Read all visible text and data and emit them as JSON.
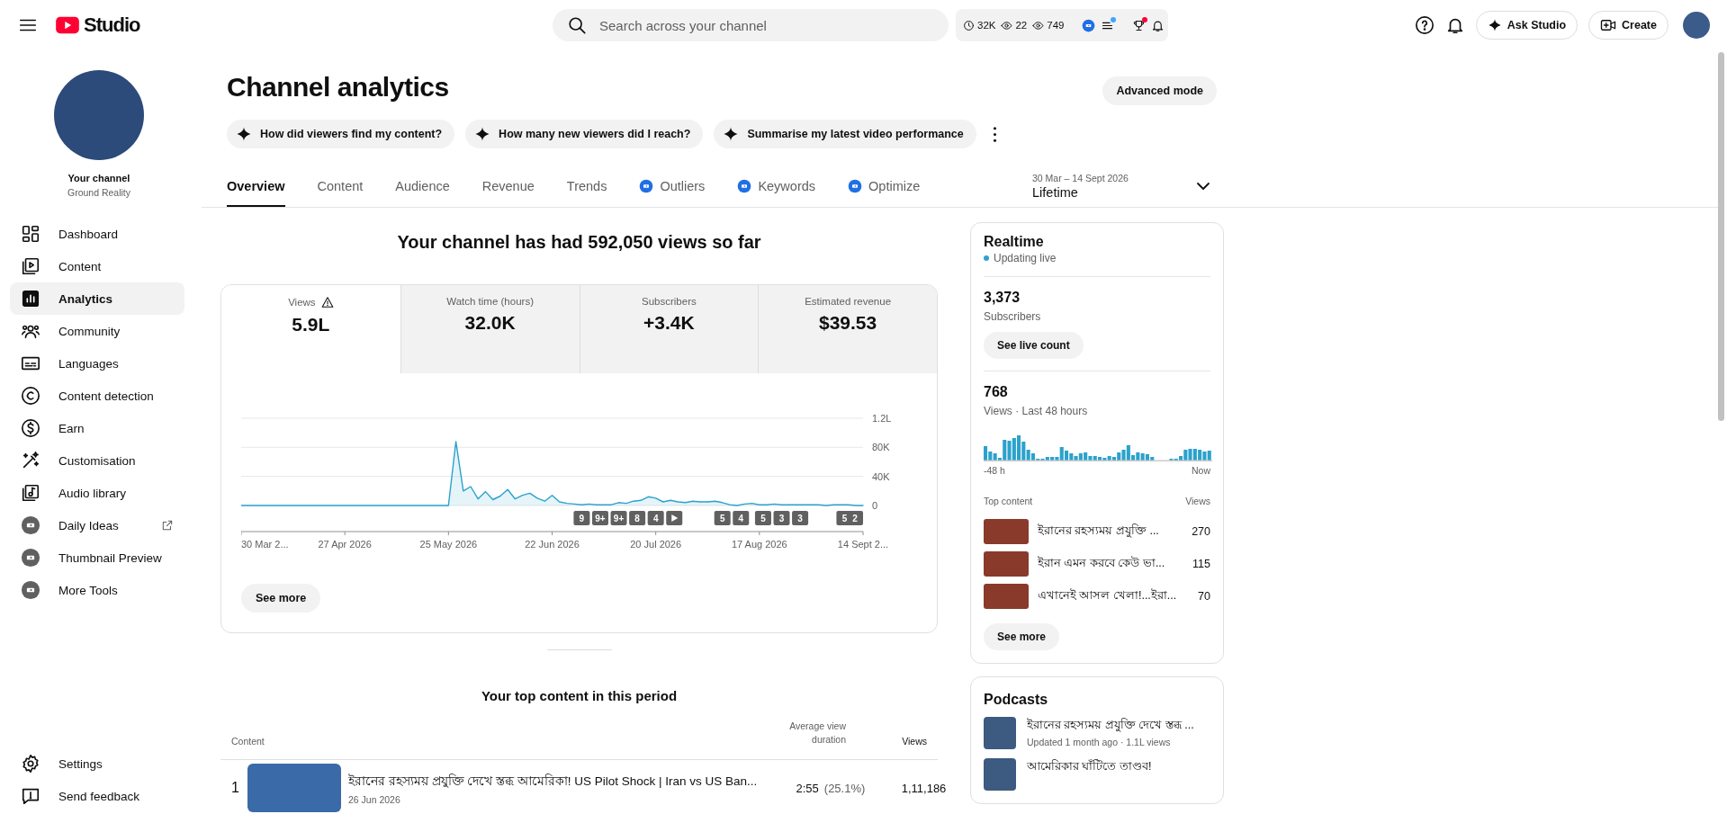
{
  "header": {
    "logo_text": "Studio",
    "search": {
      "placeholder": "Search across your channel"
    },
    "stats": [
      "32K",
      "22",
      "749"
    ],
    "toolbar_icons": [
      {
        "unread": false
      },
      {
        "unread": true,
        "color": "#3ea6ff"
      },
      {
        "unread": true,
        "color": "#ff0033"
      },
      {
        "unread": false
      }
    ],
    "ask_button": "Ask Studio",
    "create_button": "Create"
  },
  "sidebar": {
    "channel": {
      "title": "Your channel",
      "name": "Ground Reality"
    },
    "items": [
      {
        "label": "Dashboard",
        "selected": false,
        "external": false
      },
      {
        "label": "Content",
        "selected": false,
        "external": false
      },
      {
        "label": "Analytics",
        "selected": true,
        "external": false
      },
      {
        "label": "Community",
        "selected": false,
        "external": false
      },
      {
        "label": "Languages",
        "selected": false,
        "external": false
      },
      {
        "label": "Content detection",
        "selected": false,
        "external": false
      },
      {
        "label": "Earn",
        "selected": false,
        "external": false
      },
      {
        "label": "Customisation",
        "selected": false,
        "external": false
      },
      {
        "label": "Audio library",
        "selected": false,
        "external": false
      },
      {
        "label": "Daily Ideas",
        "selected": false,
        "external": true
      },
      {
        "label": "Thumbnail Preview",
        "selected": false,
        "external": false
      },
      {
        "label": "More Tools",
        "selected": false,
        "external": false
      }
    ],
    "footer_items": [
      "Settings",
      "Send feedback"
    ]
  },
  "page": {
    "title": "Channel analytics",
    "advanced_button": "Advanced mode",
    "chips": [
      "How did viewers find my content?",
      "How many new viewers did I reach?",
      "Summarise my latest video performance"
    ],
    "tabs": [
      {
        "label": "Overview",
        "selected": true,
        "badge": false
      },
      {
        "label": "Content",
        "selected": false,
        "badge": false
      },
      {
        "label": "Audience",
        "selected": false,
        "badge": false
      },
      {
        "label": "Revenue",
        "selected": false,
        "badge": false
      },
      {
        "label": "Trends",
        "selected": false,
        "badge": false
      },
      {
        "label": "Outliers",
        "selected": false,
        "badge": true
      },
      {
        "label": "Keywords",
        "selected": false,
        "badge": true
      },
      {
        "label": "Optimize",
        "selected": false,
        "badge": true
      }
    ],
    "date_range": {
      "range": "30 Mar – 14 Sept 2026",
      "period": "Lifetime"
    }
  },
  "overview": {
    "headline": "Your channel has had 592,050 views so far",
    "metrics": [
      {
        "label": "Views",
        "value": "5.9L",
        "selected": true,
        "warning": true
      },
      {
        "label": "Watch time (hours)",
        "value": "32.0K",
        "selected": false,
        "warning": false
      },
      {
        "label": "Subscribers",
        "value": "+3.4K",
        "selected": false,
        "warning": false
      },
      {
        "label": "Estimated revenue",
        "value": "$39.53",
        "selected": false,
        "warning": false
      }
    ],
    "chart_data": {
      "type": "area",
      "categories": [
        "30 Mar 2...",
        null,
        null,
        null,
        null,
        null,
        null,
        null,
        null,
        null,
        null,
        null,
        null,
        null,
        "27 Apr 2026",
        null,
        null,
        null,
        null,
        null,
        null,
        null,
        null,
        null,
        null,
        null,
        null,
        null,
        "25 May 2026",
        null,
        null,
        null,
        null,
        null,
        null,
        null,
        null,
        null,
        null,
        null,
        null,
        null,
        "22 Jun 2026",
        null,
        null,
        null,
        null,
        null,
        null,
        null,
        null,
        null,
        null,
        null,
        null,
        null,
        "20 Jul 2026",
        null,
        null,
        null,
        null,
        null,
        null,
        null,
        null,
        null,
        null,
        null,
        null,
        null,
        "17 Aug 2026",
        null,
        null,
        null,
        null,
        null,
        null,
        null,
        null,
        null,
        null,
        null,
        null,
        null,
        "14 Sept 2..."
      ],
      "series": [
        {
          "color": "#2ba2cc",
          "values": [
            0,
            0,
            0,
            0,
            0,
            0,
            0,
            0,
            0,
            0,
            0,
            0,
            0,
            0,
            0,
            0,
            0,
            0,
            0,
            0,
            0,
            0,
            0,
            0,
            0,
            0,
            0,
            0,
            0,
            88000,
            20000,
            26000,
            9000,
            19000,
            8000,
            13000,
            22000,
            9000,
            14000,
            17000,
            10000,
            6000,
            14000,
            5000,
            3000,
            2000,
            1000,
            2000,
            1000,
            1000,
            1000,
            4000,
            3000,
            6000,
            7000,
            12000,
            10000,
            5000,
            7000,
            5000,
            4000,
            6000,
            5000,
            5000,
            6000,
            4000,
            1000,
            0,
            2000,
            3000,
            1000,
            1000,
            2000,
            1000,
            1000,
            1000,
            1000,
            1000,
            1000,
            0,
            1000,
            1000,
            1000,
            0,
            0
          ]
        }
      ],
      "ylim": [
        0,
        120000
      ],
      "yticks": [
        0,
        {
          "value": 40000,
          "label": "40K"
        },
        {
          "value": 80000,
          "label": "80K"
        }
      ]
    },
    "y_axis_max_label": "1.2L",
    "video_markers": [
      {
        "kind": "count",
        "text": "9"
      },
      {
        "kind": "count",
        "text": "9+"
      },
      {
        "kind": "count",
        "text": "9+"
      },
      {
        "kind": "count",
        "text": "8"
      },
      {
        "kind": "count",
        "text": "4"
      },
      {
        "kind": "play"
      },
      {
        "kind": "count",
        "text": "5"
      },
      {
        "kind": "count",
        "text": "4"
      },
      {
        "kind": "count",
        "text": "5"
      },
      {
        "kind": "count",
        "text": "3"
      },
      {
        "kind": "count",
        "text": "3"
      },
      {
        "kind": "count",
        "text": "5"
      },
      {
        "kind": "count",
        "text": "2"
      }
    ],
    "see_more": "See more"
  },
  "top_content": {
    "title": "Your top content in this period",
    "columns": [
      "Content",
      "Average view duration",
      "Views"
    ],
    "rows": [
      {
        "rank": "1",
        "title": "ইরানের রহস্যময় প্রযুক্তি দেখে স্তব্ধ আমেরিকা! US Pilot Shock | Iran vs US Ban...",
        "date": "26 Jun 2026",
        "duration": "2:55",
        "percent": "(25.1%)",
        "views": "1,11,186"
      }
    ]
  },
  "realtime": {
    "title": "Realtime",
    "status": "Updating live",
    "live": true,
    "subscribers": "3,373",
    "subscribers_label": "Subscribers",
    "live_count_button": "See live count",
    "views": "768",
    "views_label": "Views · Last 48 hours",
    "axis_start": "-48 h",
    "axis_end": "Now",
    "top_header": "Top content",
    "views_header": "Views",
    "items": [
      {
        "title": "ইরানের রহস্যময় প্রযুক্তি ...",
        "views": "270"
      },
      {
        "title": "ইরান এমন করবে কেউ ভা...",
        "views": "115"
      },
      {
        "title": "এখানেই আসল খেলা!...ইরা...",
        "views": "70"
      }
    ],
    "see_more": "See more"
  },
  "podcasts": {
    "title": "Podcasts",
    "items": [
      {
        "title": "ইরানের রহস্যময় প্রযুক্তি দেখে স্তব্ধ ...",
        "meta": "Updated 1 month ago · 1.1L views"
      },
      {
        "title": "আমেরিকার ঘাঁটিতে তাণ্ডব!"
      }
    ]
  }
}
